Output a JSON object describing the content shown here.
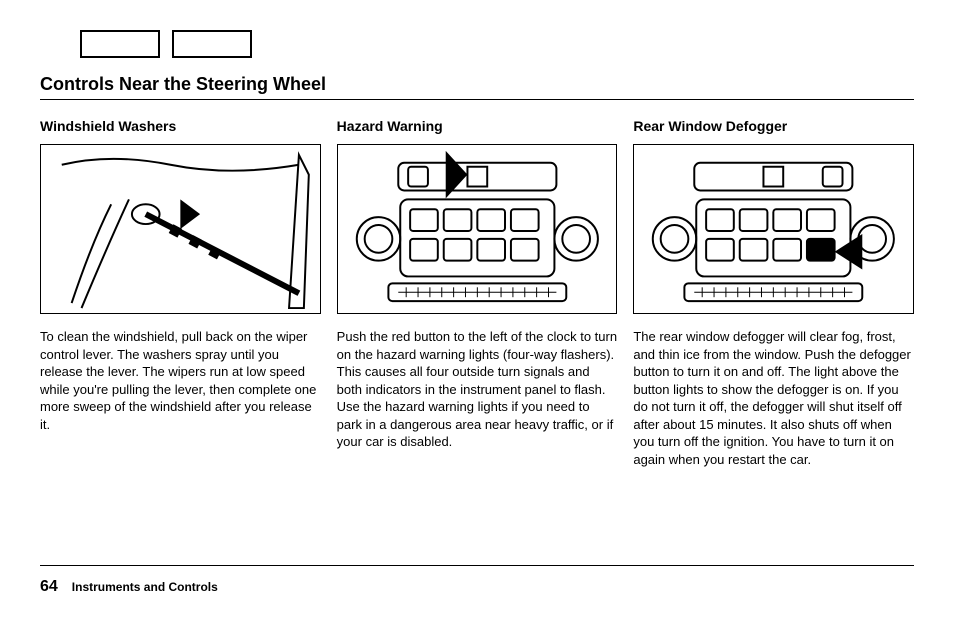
{
  "page_title": "Controls Near the Steering Wheel",
  "columns": [
    {
      "heading": "Windshield Washers",
      "body": "To clean the windshield, pull back on the wiper control lever. The washers spray until you release the lever. The wipers run at low speed while you're pulling the lever, then complete one more sweep of the windshield after you release it."
    },
    {
      "heading": "Hazard Warning",
      "body": "Push the red button to the left of the clock to turn on the hazard warning lights (four-way flashers). This causes all four outside turn signals and both indicators in the instrument panel to flash. Use the hazard warning lights if you need to park in a dangerous area near heavy traffic, or if your car is disabled."
    },
    {
      "heading": "Rear Window Defogger",
      "body": "The rear window defogger will clear fog, frost, and thin ice from the window. Push the defogger button to turn it on and off. The light above the button lights to show the defogger is on. If you do not turn it off, the defogger will shut itself off after about 15 minutes. It also shuts off when you turn off the ignition. You have to turn it on again when you restart the car."
    }
  ],
  "footer": {
    "page_number": "64",
    "chapter": "Instruments and Controls"
  }
}
